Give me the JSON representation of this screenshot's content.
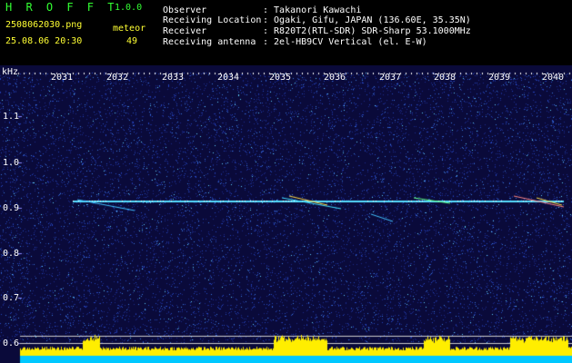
{
  "header": {
    "app_title": "H R O F F T",
    "version": "1.0.0",
    "filename": "2508062030.png",
    "datetime": "25.08.06 20:30",
    "count_label": "meteor",
    "count_value": "49"
  },
  "info": [
    {
      "label": "Observer",
      "value": ": Takanori Kawachi"
    },
    {
      "label": "Receiving Location",
      "value": ": Ogaki, Gifu, JAPAN (136.60E, 35.35N)"
    },
    {
      "label": "Receiver",
      "value": ": R820T2(RTL-SDR) SDR-Sharp 53.1000MHz"
    },
    {
      "label": "Receiving antenna",
      "value": ": 2el-HB9CV Vertical (el. E-W)"
    }
  ],
  "axis": {
    "y_unit": "kHz",
    "y_ticks": [
      "1.1",
      "1.0",
      "0.9",
      "0.8",
      "0.7",
      "0.6"
    ],
    "x_ticks": [
      "2031",
      "2032",
      "2033",
      "2034",
      "2035",
      "2036",
      "2037",
      "2038",
      "2039",
      "2040"
    ]
  },
  "colors": {
    "background": "#000000",
    "spectrogram_bg": "#0a0a3a",
    "header_green": "#33ff33",
    "header_yellow": "#ffff33",
    "carrier": "#55ddff",
    "noise_band": "#ffee00"
  }
}
